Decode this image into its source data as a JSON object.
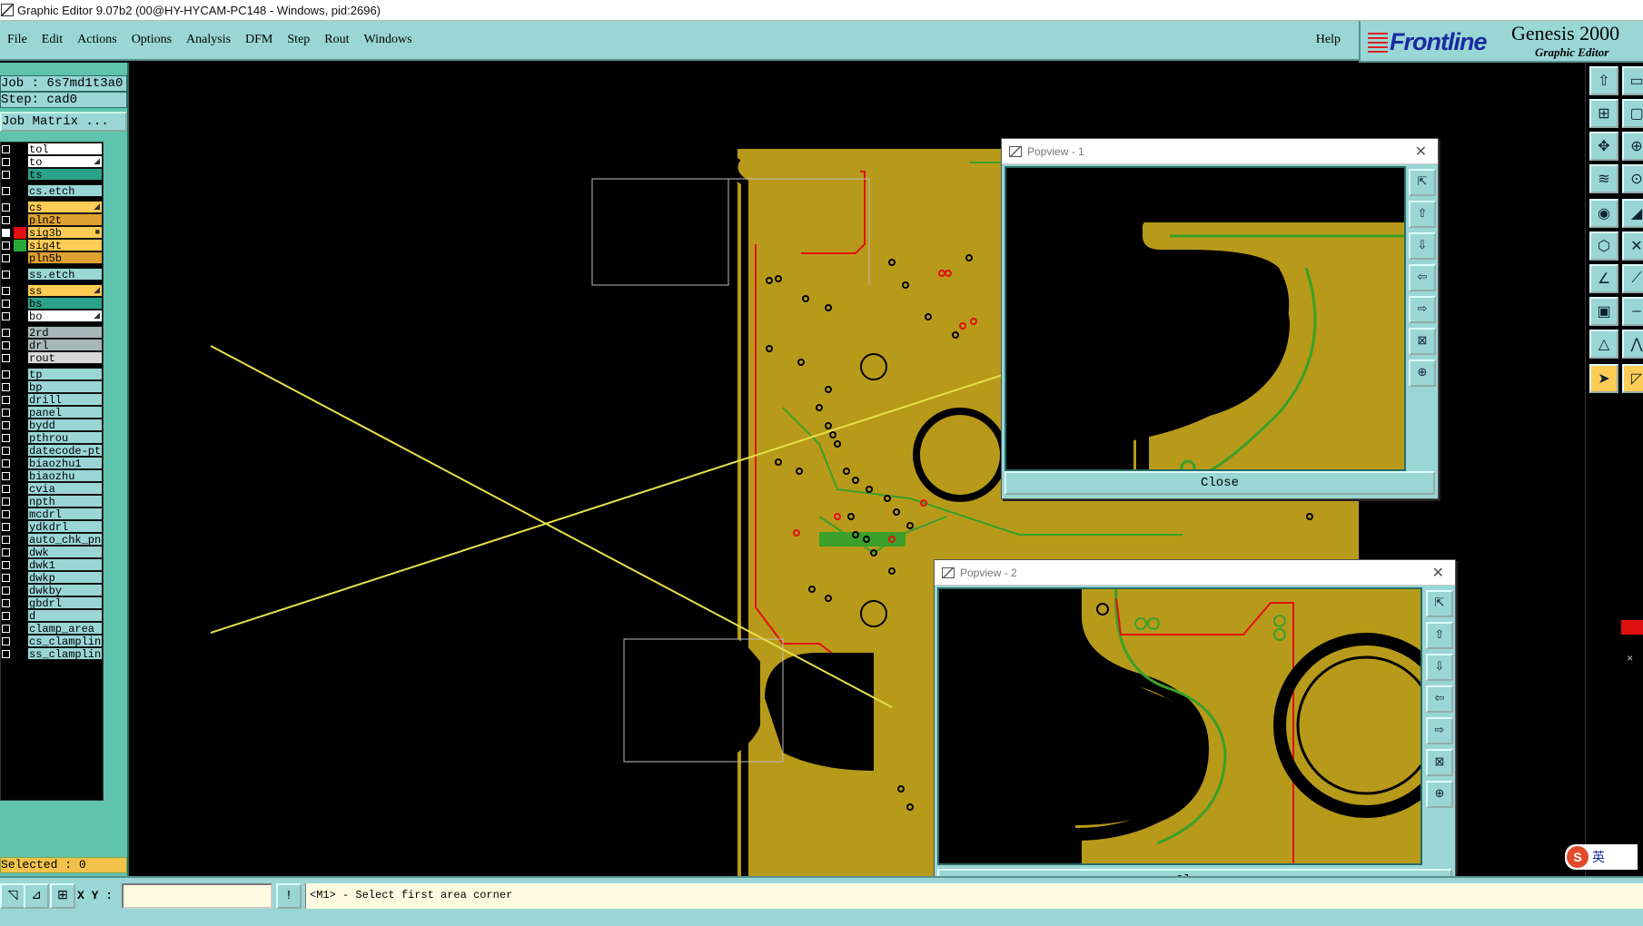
{
  "window": {
    "title": "Graphic Editor 9.07b2 (00@HY-HYCAM-PC148 - Windows, pid:2696)"
  },
  "menu": {
    "items": [
      "File",
      "Edit",
      "Actions",
      "Options",
      "Analysis",
      "DFM",
      "Step",
      "Rout",
      "Windows"
    ],
    "help": "Help"
  },
  "brand": {
    "logo": "Frontline",
    "product": "Genesis 2000",
    "subtitle": "Graphic Editor"
  },
  "info": {
    "job": "Job : 6s7md1t3a0",
    "step": "Step: cad0",
    "job_matrix": "Job Matrix ..."
  },
  "layers": [
    {
      "name": "tol",
      "color": "#ffffff",
      "marker": ""
    },
    {
      "name": "to",
      "color": "#ffffff",
      "marker": "◢"
    },
    {
      "name": "ts",
      "color": "#2aa38a",
      "marker": ""
    },
    {
      "name": "cs.etch",
      "color": "#9ad6d6",
      "marker": ""
    },
    {
      "name": "cs",
      "color": "#ffcc55",
      "marker": "◢"
    },
    {
      "name": "pln2t",
      "color": "#e0a030",
      "marker": ""
    },
    {
      "name": "sig3b",
      "color": "#ffcc55",
      "marker": "■",
      "swatch": "#e01010",
      "checked": true
    },
    {
      "name": "sig4t",
      "color": "#ffcc55",
      "marker": "",
      "swatch": "#2aa838"
    },
    {
      "name": "pln5b",
      "color": "#e0a030",
      "marker": ""
    },
    {
      "name": "ss.etch",
      "color": "#9ad6d6",
      "marker": ""
    },
    {
      "name": "ss",
      "color": "#ffcc55",
      "marker": "◢"
    },
    {
      "name": "bs",
      "color": "#2aa38a",
      "marker": ""
    },
    {
      "name": "bo",
      "color": "#ffffff",
      "marker": "◢"
    },
    {
      "name": "2rd",
      "color": "#a8b8b8",
      "marker": ""
    },
    {
      "name": "drl",
      "color": "#a8b8b8",
      "marker": ""
    },
    {
      "name": "rout",
      "color": "#d8d8d8",
      "marker": ""
    },
    {
      "name": "tp",
      "color": "#9ad6d6",
      "marker": ""
    },
    {
      "name": "bp",
      "color": "#9ad6d6",
      "marker": ""
    },
    {
      "name": "drill",
      "color": "#9ad6d6",
      "marker": ""
    },
    {
      "name": "panel",
      "color": "#9ad6d6",
      "marker": ""
    },
    {
      "name": "bydd",
      "color": "#9ad6d6",
      "marker": ""
    },
    {
      "name": "pthrou",
      "color": "#9ad6d6",
      "marker": ""
    },
    {
      "name": "datecode-ptc",
      "color": "#9ad6d6",
      "marker": ""
    },
    {
      "name": "biaozhu1",
      "color": "#9ad6d6",
      "marker": ""
    },
    {
      "name": "biaozhu",
      "color": "#9ad6d6",
      "marker": ""
    },
    {
      "name": "cvia",
      "color": "#9ad6d6",
      "marker": ""
    },
    {
      "name": "npth",
      "color": "#9ad6d6",
      "marker": ""
    },
    {
      "name": "mcdrl",
      "color": "#9ad6d6",
      "marker": ""
    },
    {
      "name": "ydkdrl",
      "color": "#9ad6d6",
      "marker": ""
    },
    {
      "name": "auto_chk_pni",
      "color": "#9ad6d6",
      "marker": ""
    },
    {
      "name": "dwk",
      "color": "#9ad6d6",
      "marker": ""
    },
    {
      "name": "dwk1",
      "color": "#9ad6d6",
      "marker": ""
    },
    {
      "name": "dwkp",
      "color": "#9ad6d6",
      "marker": ""
    },
    {
      "name": "dwkby",
      "color": "#9ad6d6",
      "marker": ""
    },
    {
      "name": "gbdrl",
      "color": "#9ad6d6",
      "marker": ""
    },
    {
      "name": "d",
      "color": "#9ad6d6",
      "marker": ""
    },
    {
      "name": "clamp_area",
      "color": "#9ad6d6",
      "marker": ""
    },
    {
      "name": "cs_clampline",
      "color": "#9ad6d6",
      "marker": ""
    },
    {
      "name": "ss_clampline",
      "color": "#9ad6d6",
      "marker": ""
    }
  ],
  "selected": "Selected : 0",
  "popview1": {
    "title": "Popview - 1",
    "close_label": "Close"
  },
  "popview2": {
    "title": "Popview - 2",
    "close_label": "Close"
  },
  "status": {
    "xy_label": "X Y :",
    "xy_value": "",
    "prompt": "<M1> - Select first area corner"
  },
  "ime": {
    "label": "英"
  },
  "colors": {
    "board": "#b89a1a",
    "trace_green": "#3aa02a",
    "trace_red": "#e01010",
    "ui_cyan": "#9ad6d6"
  }
}
